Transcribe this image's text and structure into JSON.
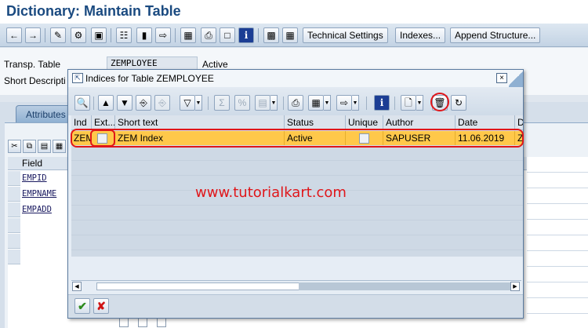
{
  "window": {
    "title": "Dictionary: Maintain Table"
  },
  "app_toolbar": {
    "icons": [
      "back-arrow-icon",
      "forward-arrow-icon",
      "other-object-icon",
      "display-change-icon",
      "activate-icon",
      "where-used-icon",
      "object-list-icon",
      "navigate-icon",
      "hierarchy-icon",
      "print-icon",
      "frame-icon",
      "info-icon",
      "layout-icon",
      "table-icon"
    ],
    "technical_settings": "Technical Settings",
    "indexes": "Indexes...",
    "append_structure": "Append Structure..."
  },
  "header": {
    "transp_table_label": "Transp. Table",
    "transp_table_value": "ZEMPLOYEE",
    "status_value": "Active",
    "short_desc_label": "Short Descripti"
  },
  "tabs": {
    "attributes": "Attributes"
  },
  "field_table": {
    "header": "Field",
    "rows": [
      "EMPID",
      "EMPNAME",
      "EMPADD"
    ]
  },
  "dialog": {
    "title": "Indices for Table ZEMPLOYEE",
    "close_glyph": "×",
    "toolbar_icons": [
      "details-icon",
      "sort-ascending-icon",
      "sort-descending-icon",
      "find-icon",
      "find-next-icon",
      "filter-icon",
      "sum-icon",
      "subtotal-icon",
      "layout-icon",
      "print-icon",
      "export-icon",
      "export-spreadsheet-icon",
      "info-icon",
      "create-icon",
      "delete-icon",
      "refresh-icon"
    ],
    "columns": [
      "Ind",
      "Ext...",
      "Short text",
      "Status",
      "Unique",
      "Author",
      "Date",
      "D"
    ],
    "rows": [
      {
        "ind": "ZEM",
        "ext": false,
        "short_text": "ZEM Index",
        "status": "Active",
        "unique": false,
        "author": "SAPUSER",
        "date": "11.06.2019",
        "d": "Z"
      }
    ],
    "footer": {
      "continue": "✔",
      "cancel": "✘"
    }
  },
  "watermark": "www.tutorialkart.com",
  "colors": {
    "title_blue": "#1a4a80",
    "selected_row": "#ffc84a",
    "annotation_red": "#e0161a"
  }
}
